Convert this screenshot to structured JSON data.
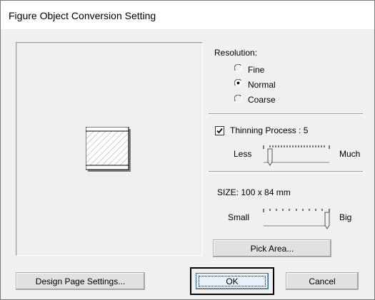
{
  "dialog": {
    "title": "Figure Object Conversion Setting"
  },
  "resolution": {
    "label": "Resolution:",
    "options": [
      "Fine",
      "Normal",
      "Coarse"
    ],
    "selected": "Normal"
  },
  "thinning": {
    "label": "Thinning Process : 5",
    "checked": true,
    "min_label": "Less",
    "max_label": "Much",
    "value_fraction": 0.1
  },
  "size": {
    "label": "SIZE:  100 x  84 mm",
    "min_label": "Small",
    "max_label": "Big",
    "value_fraction": 1.0
  },
  "buttons": {
    "pick_area": "Pick Area...",
    "design_page_settings": "Design Page Settings...",
    "ok": "OK",
    "cancel": "Cancel"
  },
  "colors": {
    "dialog_bg": "#f0f0f0",
    "accent": "#0078d7"
  }
}
